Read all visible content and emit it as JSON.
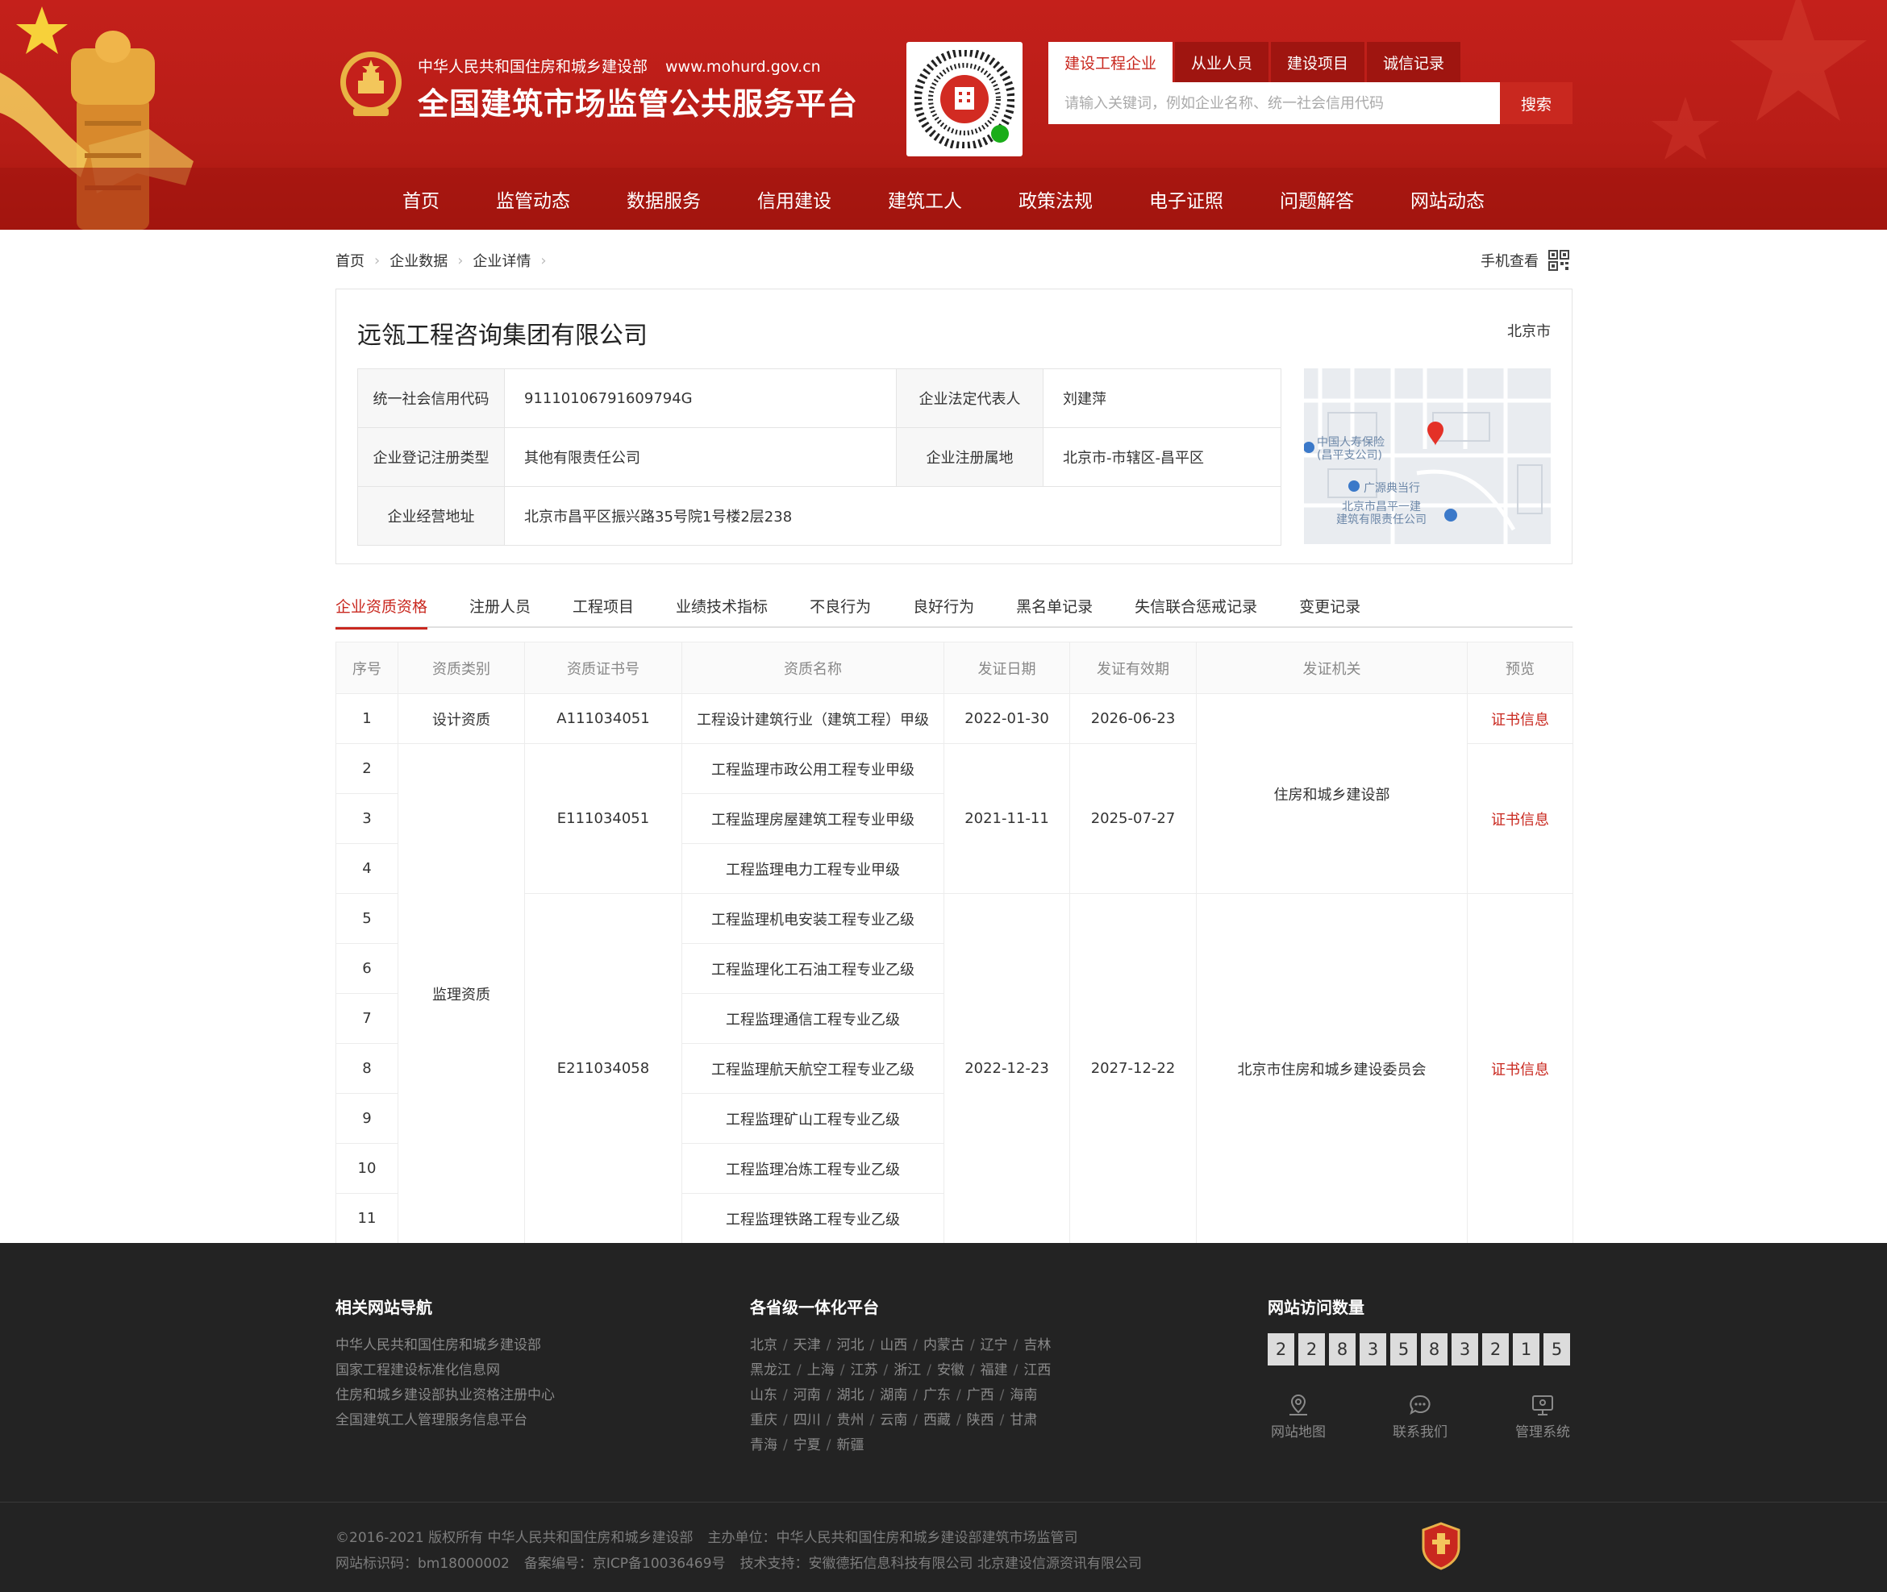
{
  "header": {
    "org_name": "中华人民共和国住房和城乡建设部",
    "org_url": "www.mohurd.gov.cn",
    "site_title": "全国建筑市场监管公共服务平台"
  },
  "search": {
    "tabs": [
      {
        "label": "建设工程企业",
        "active": true
      },
      {
        "label": "从业人员"
      },
      {
        "label": "建设项目"
      },
      {
        "label": "诚信记录"
      }
    ],
    "placeholder": "请输入关键词，例如企业名称、统一社会信用代码",
    "button_label": "搜索"
  },
  "nav": [
    "首页",
    "监管动态",
    "数据服务",
    "信用建设",
    "建筑工人",
    "政策法规",
    "电子证照",
    "问题解答",
    "网站动态"
  ],
  "breadcrumb": [
    "首页",
    "企业数据",
    "企业详情"
  ],
  "mobile_view_label": "手机查看",
  "company": {
    "name": "远瓴工程咨询集团有限公司",
    "city": "北京市",
    "credit_code_label": "统一社会信用代码",
    "credit_code": "91110106791609794G",
    "legal_rep_label": "企业法定代表人",
    "legal_rep": "刘建萍",
    "reg_type_label": "企业登记注册类型",
    "reg_type": "其他有限责任公司",
    "reg_place_label": "企业注册属地",
    "reg_place": "北京市-市辖区-昌平区",
    "address_label": "企业经营地址",
    "address": "北京市昌平区振兴路35号院1号楼2层238"
  },
  "map": {
    "poi_1": "中国人寿保险",
    "poi_1b": "(昌平支公司)",
    "poi_2": "广源典当行",
    "poi_3": "北京市昌平一建",
    "poi_3b": "建筑有限责任公司"
  },
  "tabs": [
    "企业资质资格",
    "注册人员",
    "工程项目",
    "业绩技术指标",
    "不良行为",
    "良好行为",
    "黑名单记录",
    "失信联合惩戒记录",
    "变更记录"
  ],
  "qual_table": {
    "headers": [
      "序号",
      "资质类别",
      "资质证书号",
      "资质名称",
      "发证日期",
      "发证有效期",
      "发证机关",
      "预览"
    ],
    "category_design": "设计资质",
    "category_supervision": "监理资质",
    "cert_1": "A111034051",
    "cert_2": "E111034051",
    "cert_3": "E211034058",
    "date_1": "2022-01-30",
    "expiry_1": "2026-06-23",
    "date_2": "2021-11-11",
    "expiry_2": "2025-07-27",
    "date_3": "2022-12-23",
    "expiry_3": "2027-12-22",
    "authority_1": "住房和城乡建设部",
    "authority_2": "北京市住房和城乡建设委员会",
    "preview_label": "证书信息",
    "names": [
      "工程设计建筑行业（建筑工程）甲级",
      "工程监理市政公用工程专业甲级",
      "工程监理房屋建筑工程专业甲级",
      "工程监理电力工程专业甲级",
      "工程监理机电安装工程专业乙级",
      "工程监理化工石油工程专业乙级",
      "工程监理通信工程专业乙级",
      "工程监理航天航空工程专业乙级",
      "工程监理矿山工程专业乙级",
      "工程监理冶炼工程专业乙级",
      "工程监理铁路工程专业乙级"
    ],
    "row_numbers": [
      "1",
      "2",
      "3",
      "4",
      "5",
      "6",
      "7",
      "8",
      "9",
      "10",
      "11"
    ]
  },
  "footer": {
    "related_title": "相关网站导航",
    "related_links": [
      "中华人民共和国住房和城乡建设部",
      "国家工程建设标准化信息网",
      "住房和城乡建设部执业资格注册中心",
      "全国建筑工人管理服务信息平台"
    ],
    "provinces_title": "各省级一体化平台",
    "province_rows": [
      [
        "北京",
        "天津",
        "河北",
        "山西",
        "内蒙古",
        "辽宁",
        "吉林"
      ],
      [
        "黑龙江",
        "上海",
        "江苏",
        "浙江",
        "安徽",
        "福建",
        "江西"
      ],
      [
        "山东",
        "河南",
        "湖北",
        "湖南",
        "广东",
        "广西",
        "海南"
      ],
      [
        "重庆",
        "四川",
        "贵州",
        "云南",
        "西藏",
        "陕西",
        "甘肃"
      ],
      [
        "青海",
        "宁夏",
        "新疆"
      ]
    ],
    "visits_title": "网站访问数量",
    "visit_digits": [
      "2",
      "2",
      "8",
      "3",
      "5",
      "8",
      "3",
      "2",
      "1",
      "5"
    ],
    "sitemap_label": "网站地图",
    "contact_label": "联系我们",
    "admin_label": "管理系统",
    "copyright_line1a": "©2016-2021 版权所有 中华人民共和国住房和城乡建设部",
    "copyright_line1b": "主办单位：中华人民共和国住房和城乡建设部建筑市场监管司",
    "copyright_line2a": "网站标识码：bm18000002",
    "copyright_line2b": "备案编号：京ICP备10036469号",
    "copyright_line2c": "技术支持：安徽德拓信息科技有限公司 北京建设信源资讯有限公司"
  },
  "colors": {
    "brand_red": "#c9281f",
    "header_red": "#b81d17",
    "footer_bg": "#232323"
  }
}
